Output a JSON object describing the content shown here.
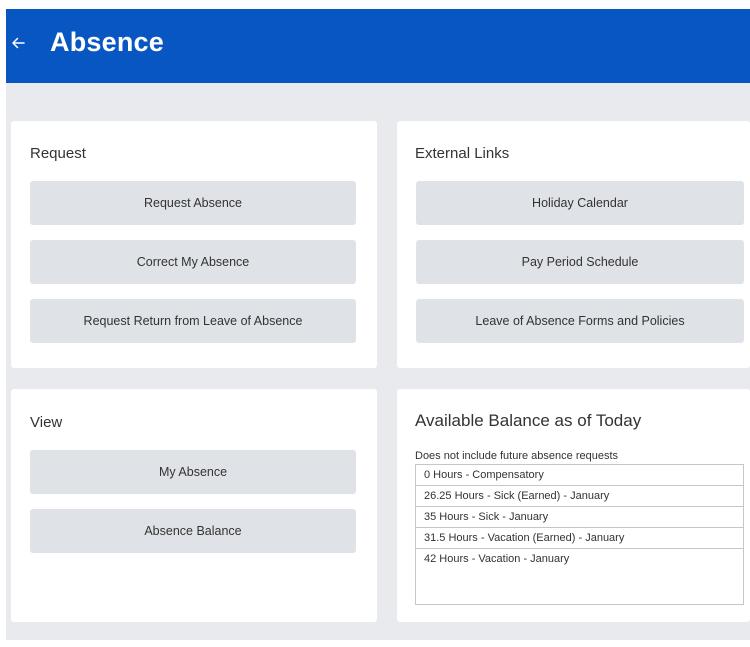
{
  "header": {
    "title": "Absence",
    "background_color": "#0756c1",
    "back_icon": "arrow-left-icon"
  },
  "request_card": {
    "title": "Request",
    "buttons": [
      "Request Absence",
      "Correct My Absence",
      "Request Return from Leave of Absence"
    ]
  },
  "external_links_card": {
    "title": "External Links",
    "buttons": [
      "Holiday Calendar",
      "Pay Period Schedule",
      "Leave of Absence Forms and Policies"
    ]
  },
  "view_card": {
    "title": "View",
    "buttons": [
      "My Absence",
      "Absence Balance"
    ]
  },
  "balance_card": {
    "title": "Available Balance as of Today",
    "note": "Does not include future absence requests",
    "rows": [
      "0 Hours - Compensatory",
      "26.25 Hours - Sick (Earned) - January",
      "35 Hours - Sick - January",
      "31.5 Hours - Vacation (Earned) - January",
      "42 Hours - Vacation - January"
    ]
  },
  "colors": {
    "canvas_background": "#e8eaed",
    "button_background": "#dfe2e6",
    "card_background": "#ffffff"
  }
}
